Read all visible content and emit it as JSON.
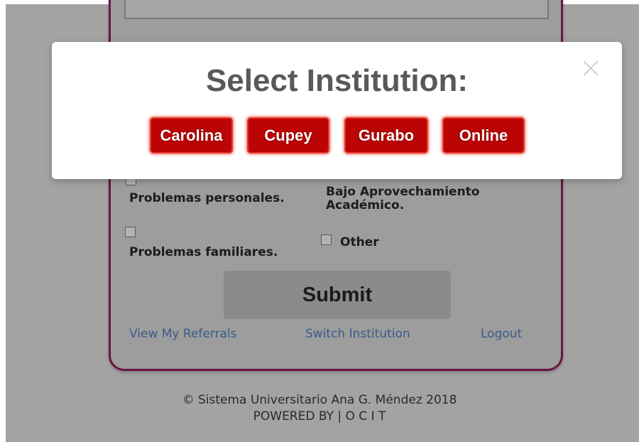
{
  "form": {
    "options": [
      {
        "label": "Problemas personales."
      },
      {
        "label": "Bajo Aprovechamiento Académico."
      },
      {
        "label": "Problemas familiares."
      },
      {
        "label": "Other"
      }
    ],
    "submit_label": "Submit",
    "links": {
      "view_referrals": "View My Referrals",
      "switch_institution": "Switch Institution",
      "logout": "Logout"
    }
  },
  "footer": {
    "copyright": "© Sistema Universitario Ana G. Méndez 2018",
    "powered_by": "POWERED BY | O C I T"
  },
  "modal": {
    "title": "Select Institution:",
    "close_icon": "close-icon",
    "institutions": [
      "Carolina",
      "Cupey",
      "Gurabo",
      "Online"
    ]
  },
  "colors": {
    "institution_button": "#bb0505",
    "card_border": "#6b1544",
    "link": "#3a5a86",
    "overlay": "#a3a3a3"
  }
}
